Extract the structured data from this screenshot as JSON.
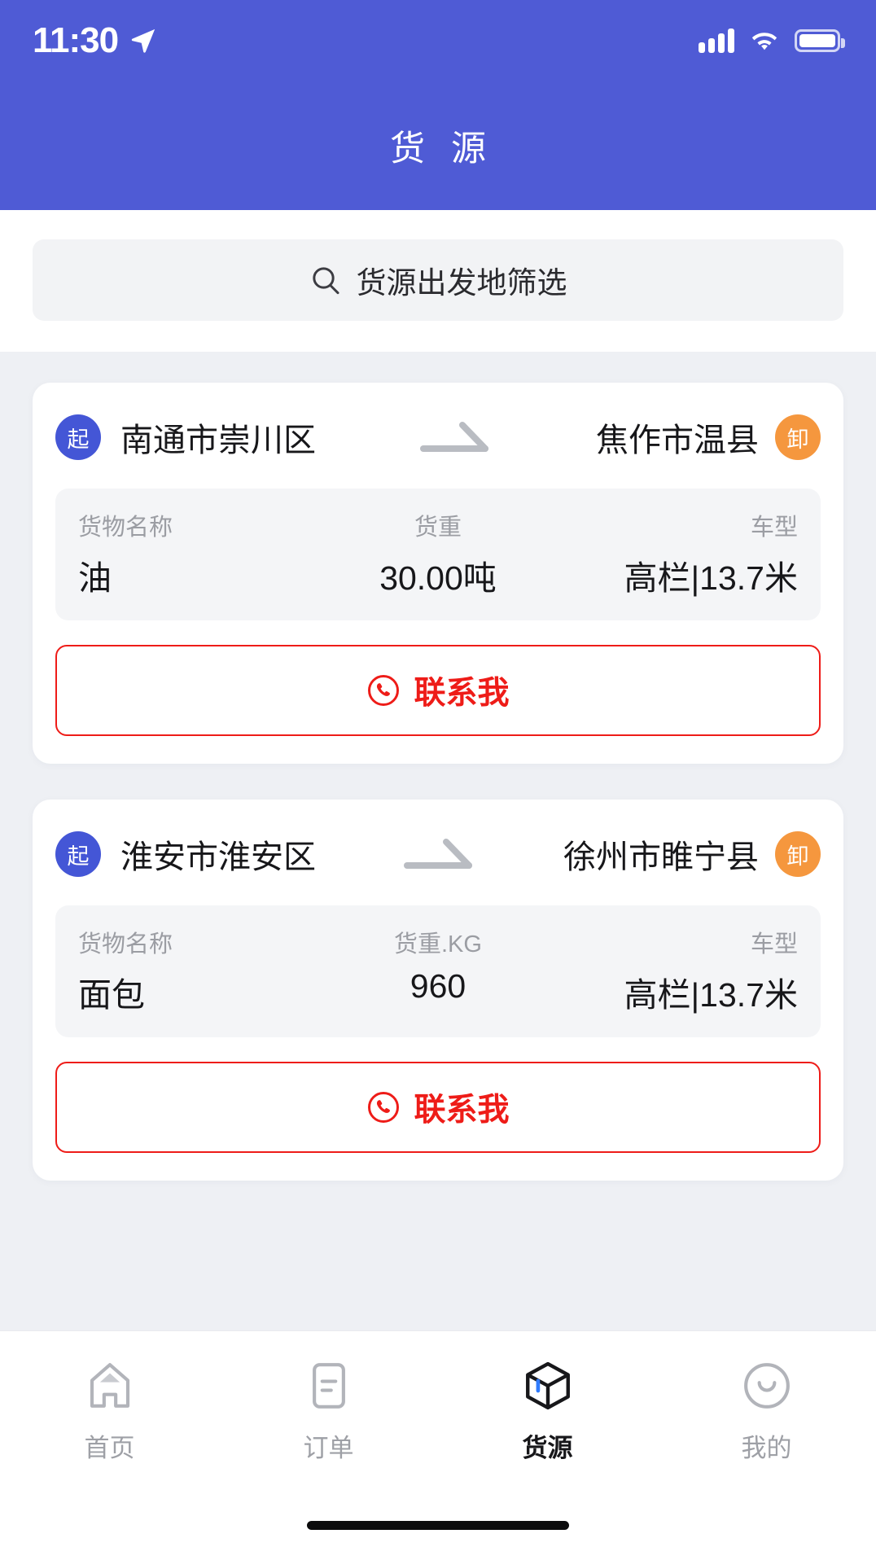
{
  "status_bar": {
    "time": "11:30",
    "location_icon": "location-arrow-icon",
    "signal_icon": "cellular-signal-icon",
    "wifi_icon": "wifi-icon",
    "battery_icon": "battery-icon"
  },
  "header": {
    "title": "货 源",
    "background_color": "#4f5bd5"
  },
  "search": {
    "icon": "search-icon",
    "placeholder": "货源出发地筛选"
  },
  "colors": {
    "brand": "#4f5bd5",
    "start_badge": "#4456d6",
    "end_badge": "#f5973e",
    "contact_red": "#ee1c18",
    "page_background": "#eef0f4",
    "info_panel": "#f4f5f7"
  },
  "cards": [
    {
      "start_badge": "起",
      "origin": "南通市崇川区",
      "route_arrow_icon": "route-arrow-icon",
      "destination": "焦作市温县",
      "end_badge": "卸",
      "fields": [
        {
          "label": "货物名称",
          "value": "油"
        },
        {
          "label": "货重",
          "value": "30.00吨"
        },
        {
          "label": "车型",
          "value": "高栏|13.7米"
        }
      ],
      "contact": {
        "icon": "phone-icon",
        "label": "联系我"
      }
    },
    {
      "start_badge": "起",
      "origin": "淮安市淮安区",
      "route_arrow_icon": "route-arrow-icon",
      "destination": "徐州市睢宁县",
      "end_badge": "卸",
      "fields": [
        {
          "label": "货物名称",
          "value": "面包"
        },
        {
          "label": "货重.KG",
          "value": "960"
        },
        {
          "label": "车型",
          "value": "高栏|13.7米"
        }
      ],
      "contact": {
        "icon": "phone-icon",
        "label": "联系我"
      }
    }
  ],
  "tabbar": {
    "items": [
      {
        "label": "首页",
        "icon": "home-icon",
        "active": false
      },
      {
        "label": "订单",
        "icon": "order-list-icon",
        "active": false
      },
      {
        "label": "货源",
        "icon": "cargo-cube-icon",
        "active": true
      },
      {
        "label": "我的",
        "icon": "profile-smiley-icon",
        "active": false
      }
    ]
  }
}
